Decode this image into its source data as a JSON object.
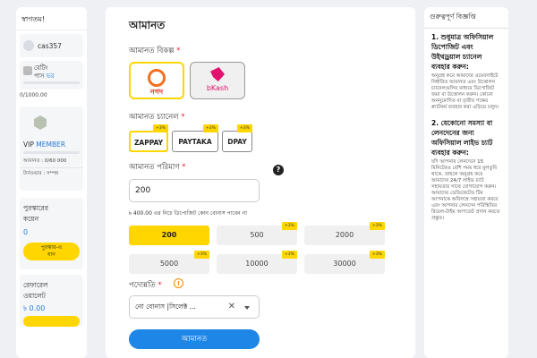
{
  "sidebar": {
    "greeting": "স্বাগতম!",
    "username": "cas357",
    "betting_pass": {
      "line1": "বেটিং",
      "line2": "পাস",
      "level": "ভর",
      "value": "0/1000.00"
    },
    "vip": {
      "label": "VIP",
      "level": "MEMBER",
      "progress": "আমানত : 0/60 000",
      "status": "টার্নওভার : সম্পন্ন"
    },
    "bonus": {
      "title_line1": "পুরস্কারের",
      "title_line2": "কয়েন",
      "value": "0",
      "button_line1": "পুরস্কার-এ",
      "button_line2": "যান"
    },
    "wallet": {
      "title_line1": "রেফারেল",
      "title_line2": "ওয়ালেট",
      "value": "৳ 0.00"
    }
  },
  "main": {
    "title": "আমানত",
    "method_label": "আমানত বিকল্প",
    "methods": [
      {
        "name": "nagad",
        "label": "নগদ"
      },
      {
        "name": "bkash",
        "label": "bKash"
      }
    ],
    "channel_label": "আমানত চ্যানেল",
    "channels": [
      {
        "label": "ZAPPAY",
        "tag": "+3%",
        "selected": true
      },
      {
        "label": "PAYTAKA",
        "tag": "+3%",
        "selected": false
      },
      {
        "label": "DPAY",
        "tag": "+3%",
        "selected": false
      }
    ],
    "amount_label": "আমানত পরিমাণ",
    "amount_value": "200",
    "note": "৳ 400.00 এর নিচে ডিপোজিট কোন বোনাস পাবেন না",
    "quick_amounts": [
      {
        "label": "200",
        "tag": "",
        "selected": true
      },
      {
        "label": "500",
        "tag": "+3%",
        "selected": false
      },
      {
        "label": "2000",
        "tag": "+3%",
        "selected": false
      },
      {
        "label": "5000",
        "tag": "+3%",
        "selected": false
      },
      {
        "label": "10000",
        "tag": "+3%",
        "selected": false
      },
      {
        "label": "30000",
        "tag": "+3%",
        "selected": false
      }
    ],
    "promo_label": "পদোন্নতি",
    "promo_value": "নো বোনাস |সিলেক্ট ...",
    "submit_label": "আমানত",
    "required_mark": "*",
    "help_glyph": "?",
    "promo_warning_glyph": "!",
    "clear_glyph": "✕"
  },
  "notice": {
    "title": "গুরুত্বপূর্ণ বিজ্ঞপ্তি",
    "sections": [
      {
        "heading": "1. শুধুমাত্র অফিসিয়াল ডিপোজিট এবং উইথড্রয়াল চ্যানেল ব্যবহার করুন:",
        "body": "অনুগ্রহ করে আমাদের ওয়েবসাইটে নির্ধারিত আমানত এবং উত্তোলন চ্যানেলগুলির মাধ্যমে ডিপোজিট জমা বা উত্তোলন করুন। কোনো অননুমোদিত বা তৃতীয় পক্ষের প্ল্যাটফর্ম ব্যবহার করা এড়িয়ে চলুন।"
      },
      {
        "heading": "2. যেকোনো সমস্যা বা লেনদেনের জন্য অফিসিয়াল লাইভ চ্যাট ব্যবহার করুন:",
        "body": "যদি আপনার লেনদেনে 15 মিনিটেরও বেশি সময় ধরে মুলতুবি থাকে, তাহলে অনুগ্রহ করে আমাদের 24/7 লাইভ চ্যাট সহায়তার সাথে যোগাযোগ করুন। আমাদের ডেডিকেটেড টিম আপনাকে অবিলম্বে সহায়তা করবে এবং আপনার লেনদেন পরিস্থিতির রিয়েল-টাইম আপডেট প্রদান করতে প্রস্তুত।"
      }
    ]
  }
}
